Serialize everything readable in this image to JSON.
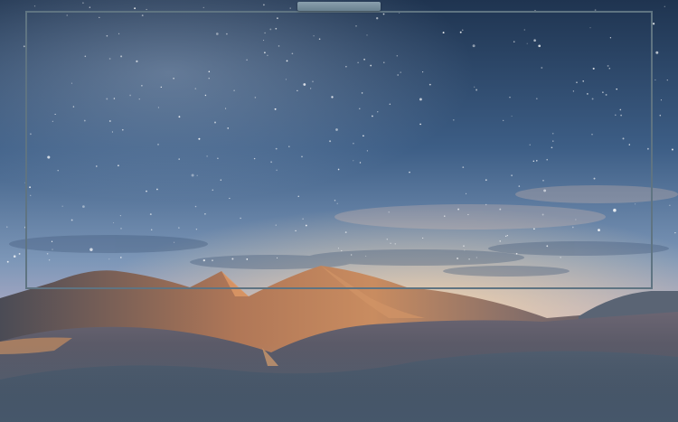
{
  "scene": {
    "description_free": true,
    "palette": {
      "sky_top": "#20344f",
      "sky_mid": "#4f6f96",
      "sky_low": "#9fb3cc",
      "horizon_glow": "#f2c9a2",
      "horizon_pink": "#c9a6bd",
      "dune_lit": "#c88a5e",
      "dune_shadow": "#3c4a5c",
      "dune_dark": "#263445",
      "frame_edge": "#5f7482",
      "webcam": "#8aa0ad"
    }
  }
}
